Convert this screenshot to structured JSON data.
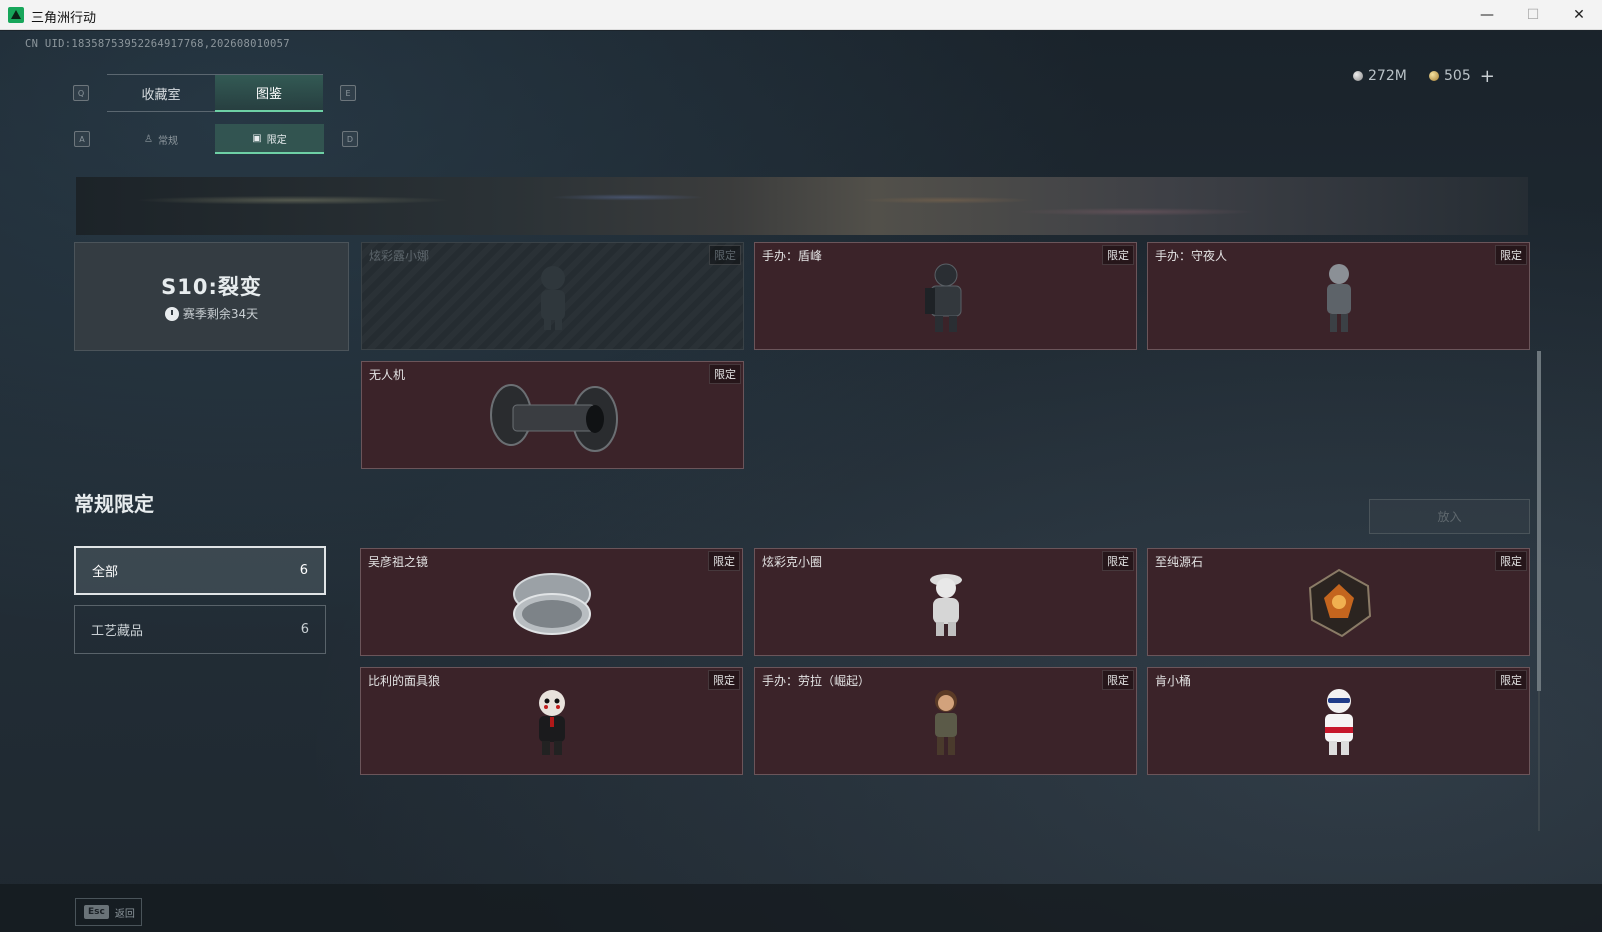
{
  "window": {
    "title": "三角洲行动",
    "minimize": "—",
    "maximize": "☐",
    "close": "✕"
  },
  "uid": "CN UID:18358753952264917768,202608010057",
  "currency": {
    "silver": "272M",
    "gold": "505",
    "add": "+"
  },
  "tabs": {
    "prev_key": "Q",
    "next_key": "E",
    "items": [
      {
        "label": "收藏室",
        "active": false
      },
      {
        "label": "图鉴",
        "active": true
      }
    ]
  },
  "subtabs": {
    "prev_key": "A",
    "next_key": "D",
    "items": [
      {
        "label": "常规",
        "icon": "figure-icon",
        "active": false
      },
      {
        "label": "限定",
        "icon": "image-icon",
        "active": true
      }
    ]
  },
  "season": {
    "title": "S10:裂变",
    "remaining": "赛季剩余34天"
  },
  "limited_tag": "限定",
  "season_items": [
    {
      "name": "炫彩露小娜",
      "locked": true
    },
    {
      "name": "手办：盾峰",
      "locked": false
    },
    {
      "name": "手办：守夜人",
      "locked": false
    },
    {
      "name": "无人机",
      "locked": false
    }
  ],
  "regular_section": {
    "title": "常规限定",
    "filters": [
      {
        "label": "全部",
        "count": "6",
        "active": true
      },
      {
        "label": "工艺藏品",
        "count": "6",
        "active": false
      }
    ],
    "put_button": "放入",
    "items": [
      {
        "name": "吴彦祖之镜"
      },
      {
        "name": "炫彩克小圈"
      },
      {
        "name": "至纯源石"
      },
      {
        "name": "比利的面具狼"
      },
      {
        "name": "手办：劳拉（崛起）"
      },
      {
        "name": "肯小桶"
      }
    ]
  },
  "footer": {
    "esc_key": "Esc",
    "back_label": "返回"
  }
}
